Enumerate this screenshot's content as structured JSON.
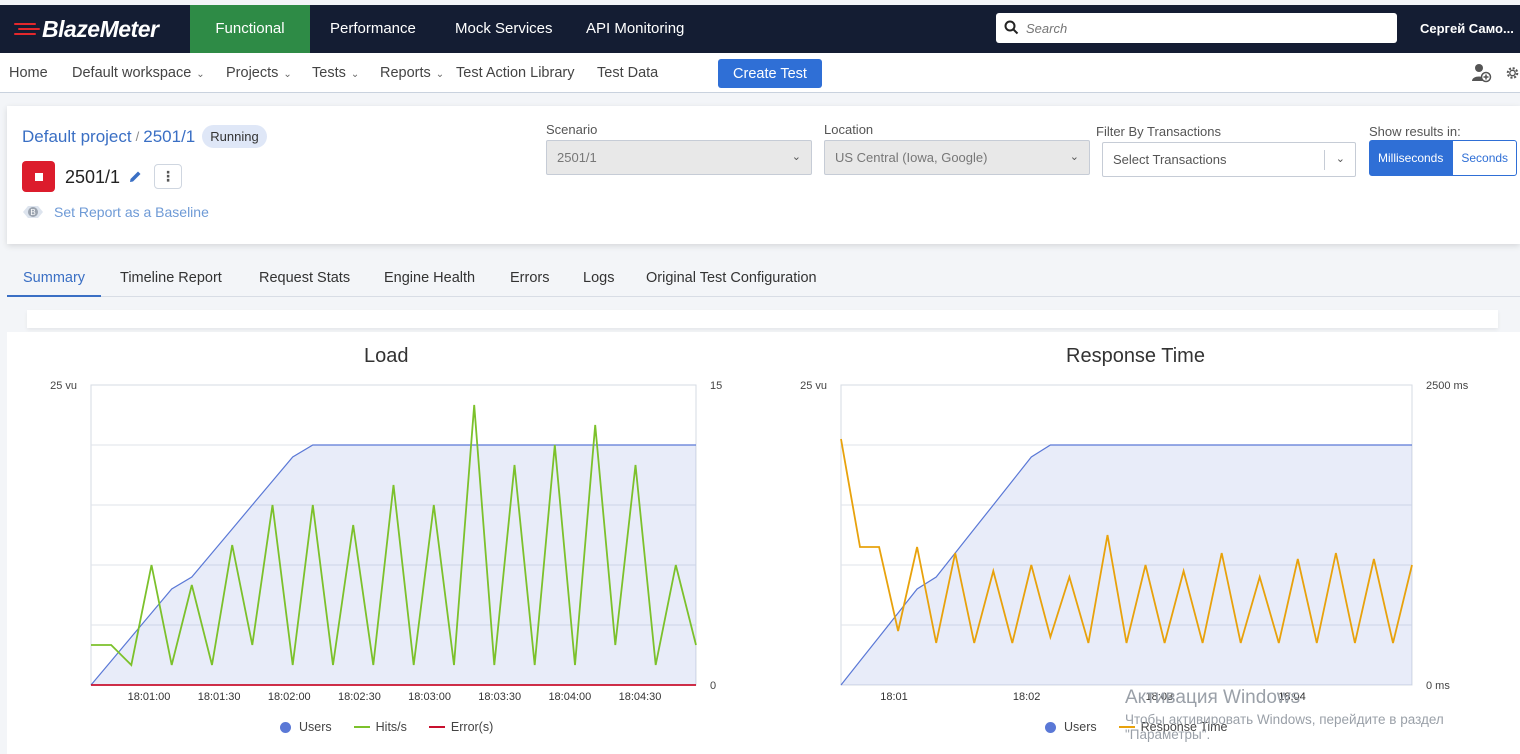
{
  "brand": {
    "name": "BlazeMeter",
    "accent": "#e3282c"
  },
  "topnav": {
    "items": [
      "Functional",
      "Performance",
      "Mock Services",
      "API Monitoring"
    ],
    "active": "Functional",
    "search_placeholder": "Search",
    "user": "Сергей Само..."
  },
  "subnav": {
    "home": "Home",
    "workspace": "Default workspace",
    "projects": "Projects",
    "tests": "Tests",
    "reports": "Reports",
    "action_library": "Test Action Library",
    "test_data": "Test Data",
    "create_test": "Create Test"
  },
  "header": {
    "project": "Default project",
    "separator": "/",
    "test": "2501/1",
    "status": "Running",
    "test_name": "2501/1",
    "baseline": "Set Report as a Baseline"
  },
  "filters": {
    "scenario_label": "Scenario",
    "scenario_value": "2501/1",
    "location_label": "Location",
    "location_value": "US Central (Iowa, Google)",
    "transactions_label": "Filter By Transactions",
    "transactions_placeholder": "Select Transactions",
    "results_label": "Show results in:",
    "unit_ms": "Milliseconds",
    "unit_s": "Seconds",
    "unit_selected": "Milliseconds"
  },
  "tabs": [
    "Summary",
    "Timeline Report",
    "Request Stats",
    "Engine Health",
    "Errors",
    "Logs",
    "Original Test Configuration"
  ],
  "active_tab": "Summary",
  "chart_data": [
    {
      "type": "line",
      "title": "Load",
      "x_ticks": [
        "18:01:00",
        "18:01:30",
        "18:02:00",
        "18:02:30",
        "18:03:00",
        "18:03:30",
        "18:04:00",
        "18:04:30"
      ],
      "y_left_ticks": [
        "25 vu"
      ],
      "y_right_ticks": [
        "15",
        "0"
      ],
      "y_left_range": [
        0,
        25
      ],
      "y_right_range": [
        0,
        15
      ],
      "legend": [
        "Users",
        "Hits/s",
        "Error(s)"
      ],
      "colors": {
        "Users": "#5a78d6",
        "Hits/s": "#7cc12b",
        "Error(s)": "#c8102e"
      },
      "series": [
        {
          "name": "Users",
          "axis": "left",
          "values": [
            0,
            2,
            4,
            6,
            8,
            9,
            11,
            13,
            15,
            17,
            19,
            20,
            20,
            20,
            20,
            20,
            20,
            20,
            20,
            20,
            20,
            20,
            20,
            20,
            20,
            20,
            20,
            20,
            20,
            20,
            20
          ]
        },
        {
          "name": "Hits/s",
          "axis": "right",
          "values": [
            2,
            2,
            1,
            6,
            1,
            5,
            1,
            7,
            2,
            9,
            1,
            9,
            1,
            8,
            1,
            10,
            1,
            9,
            1,
            14,
            1,
            11,
            1,
            12,
            1,
            13,
            2,
            11,
            1,
            6,
            2
          ]
        },
        {
          "name": "Error(s)",
          "axis": "right",
          "values": [
            0,
            0,
            0,
            0,
            0,
            0,
            0,
            0,
            0,
            0,
            0,
            0,
            0,
            0,
            0,
            0,
            0,
            0,
            0,
            0,
            0,
            0,
            0,
            0,
            0,
            0,
            0,
            0,
            0,
            0,
            0
          ]
        }
      ]
    },
    {
      "type": "line",
      "title": "Response Time",
      "x_ticks": [
        "18:01",
        "18:02",
        "18:03",
        "18:04"
      ],
      "y_left_ticks": [
        "25 vu"
      ],
      "y_right_ticks": [
        "2500 ms",
        "0 ms"
      ],
      "y_left_range": [
        0,
        25
      ],
      "y_right_range": [
        0,
        2500
      ],
      "legend": [
        "Users",
        "Response Time"
      ],
      "colors": {
        "Users": "#5a78d6",
        "Response Time": "#e8a20c"
      },
      "series": [
        {
          "name": "Users",
          "axis": "left",
          "values": [
            0,
            2,
            4,
            6,
            8,
            9,
            11,
            13,
            15,
            17,
            19,
            20,
            20,
            20,
            20,
            20,
            20,
            20,
            20,
            20,
            20,
            20,
            20,
            20,
            20,
            20,
            20,
            20,
            20,
            20,
            20
          ]
        },
        {
          "name": "Response Time",
          "axis": "right",
          "values": [
            2050,
            1150,
            1150,
            450,
            1150,
            350,
            1100,
            350,
            950,
            350,
            1000,
            400,
            900,
            350,
            1250,
            350,
            1000,
            350,
            950,
            350,
            1100,
            350,
            900,
            350,
            1050,
            350,
            1100,
            350,
            1050,
            350,
            1000
          ]
        }
      ]
    }
  ],
  "watermark": {
    "title": "Активация Windows",
    "line1": "Чтобы активировать Windows, перейдите в раздел",
    "line2": "\"Параметры\"."
  }
}
